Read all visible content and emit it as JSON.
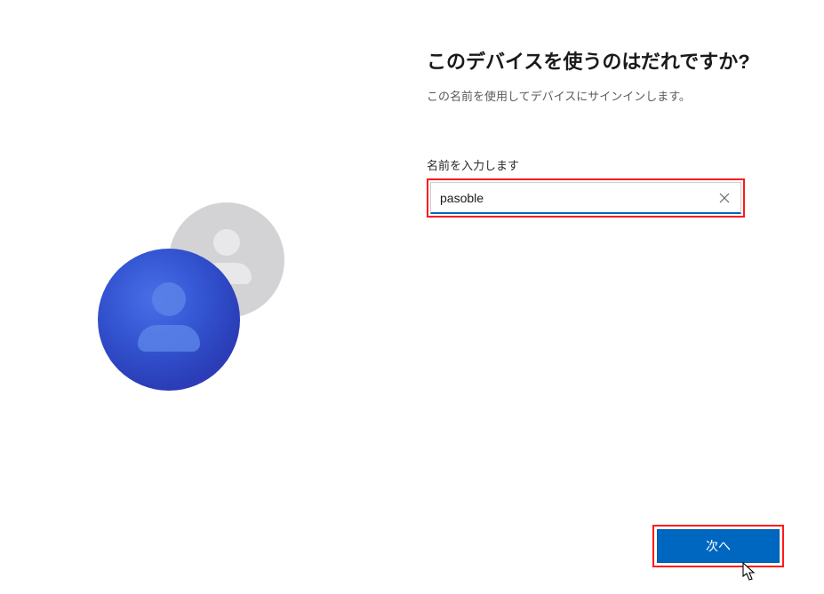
{
  "heading": "このデバイスを使うのはだれですか?",
  "subheading": "この名前を使用してデバイスにサインインします。",
  "field": {
    "label": "名前を入力します",
    "value": "pasoble"
  },
  "buttons": {
    "next": "次へ"
  }
}
